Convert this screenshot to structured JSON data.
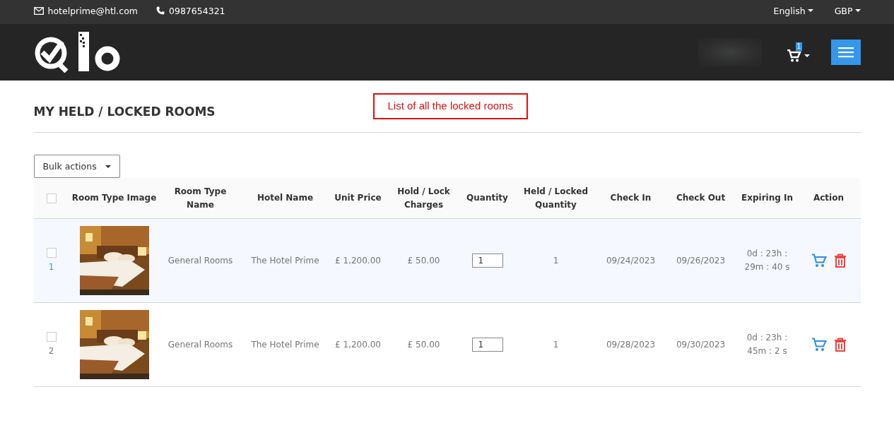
{
  "topbar": {
    "email": "hotelprime@htl.com",
    "phone": "0987654321",
    "language": "English",
    "currency": "GBP"
  },
  "header": {
    "cart_count": "1"
  },
  "page": {
    "title": "MY HELD / LOCKED ROOMS",
    "annotation": "List of all the locked rooms",
    "bulk_actions": "Bulk actions"
  },
  "table": {
    "select_all_checked": false,
    "columns": [
      "Room Type Image",
      "Room Type Name",
      "Hotel Name",
      "Unit Price",
      "Hold / Lock Charges",
      "Quantity",
      "Held / Locked Quantity",
      "Check In",
      "Check Out",
      "Expiring In",
      "Action"
    ],
    "rows": [
      {
        "index": "1",
        "checked": false,
        "highlighted": true,
        "room_type": "General Rooms",
        "hotel": "The Hotel Prime",
        "unit_price": "£ 1,200.00",
        "charges": "£ 50.00",
        "quantity": "1",
        "held_quantity": "1",
        "check_in": "09/24/2023",
        "check_out": "09/26/2023",
        "expiring_in": "0d : 23h : 29m : 40 s"
      },
      {
        "index": "2",
        "checked": false,
        "highlighted": false,
        "room_type": "General Rooms",
        "hotel": "The Hotel Prime",
        "unit_price": "£ 1,200.00",
        "charges": "£ 50.00",
        "quantity": "1",
        "held_quantity": "1",
        "check_in": "09/28/2023",
        "check_out": "09/30/2023",
        "expiring_in": "0d : 23h : 45m : 2 s"
      }
    ]
  }
}
